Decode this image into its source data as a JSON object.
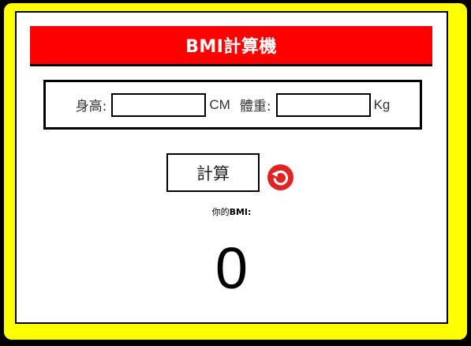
{
  "app": {
    "title": "BMI計算機"
  },
  "form": {
    "height_label": "身高:",
    "height_value": "",
    "height_unit": "CM",
    "weight_label": "體重:",
    "weight_value": "",
    "weight_unit": "Kg"
  },
  "actions": {
    "calculate_label": "計算",
    "reset_icon": "reset-icon"
  },
  "result": {
    "label_prefix": "你的",
    "label_strong": "BMI:",
    "value": "0"
  },
  "colors": {
    "frame": "#ffff00",
    "title_bar": "#ff0000",
    "reset_icon": "#e02424"
  }
}
